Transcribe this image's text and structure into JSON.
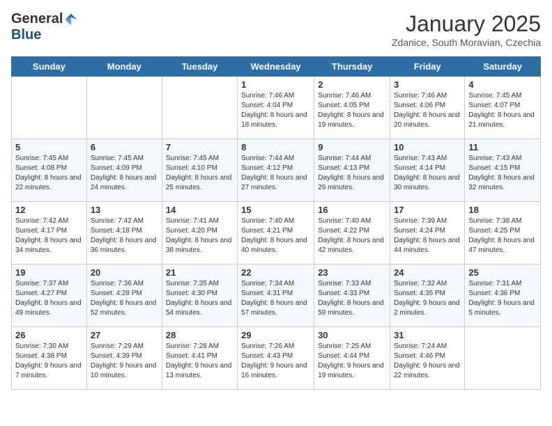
{
  "logo": {
    "general": "General",
    "blue": "Blue"
  },
  "title": "January 2025",
  "subtitle": "Zdanice, South Moravian, Czechia",
  "days": [
    "Sunday",
    "Monday",
    "Tuesday",
    "Wednesday",
    "Thursday",
    "Friday",
    "Saturday"
  ],
  "weeks": [
    [
      {
        "day": "",
        "info": ""
      },
      {
        "day": "",
        "info": ""
      },
      {
        "day": "",
        "info": ""
      },
      {
        "day": "1",
        "info": "Sunrise: 7:46 AM\nSunset: 4:04 PM\nDaylight: 8 hours and 18 minutes."
      },
      {
        "day": "2",
        "info": "Sunrise: 7:46 AM\nSunset: 4:05 PM\nDaylight: 8 hours and 19 minutes."
      },
      {
        "day": "3",
        "info": "Sunrise: 7:46 AM\nSunset: 4:06 PM\nDaylight: 8 hours and 20 minutes."
      },
      {
        "day": "4",
        "info": "Sunrise: 7:45 AM\nSunset: 4:07 PM\nDaylight: 8 hours and 21 minutes."
      }
    ],
    [
      {
        "day": "5",
        "info": "Sunrise: 7:45 AM\nSunset: 4:08 PM\nDaylight: 8 hours and 22 minutes."
      },
      {
        "day": "6",
        "info": "Sunrise: 7:45 AM\nSunset: 4:09 PM\nDaylight: 8 hours and 24 minutes."
      },
      {
        "day": "7",
        "info": "Sunrise: 7:45 AM\nSunset: 4:10 PM\nDaylight: 8 hours and 25 minutes."
      },
      {
        "day": "8",
        "info": "Sunrise: 7:44 AM\nSunset: 4:12 PM\nDaylight: 8 hours and 27 minutes."
      },
      {
        "day": "9",
        "info": "Sunrise: 7:44 AM\nSunset: 4:13 PM\nDaylight: 8 hours and 29 minutes."
      },
      {
        "day": "10",
        "info": "Sunrise: 7:43 AM\nSunset: 4:14 PM\nDaylight: 8 hours and 30 minutes."
      },
      {
        "day": "11",
        "info": "Sunrise: 7:43 AM\nSunset: 4:15 PM\nDaylight: 8 hours and 32 minutes."
      }
    ],
    [
      {
        "day": "12",
        "info": "Sunrise: 7:42 AM\nSunset: 4:17 PM\nDaylight: 8 hours and 34 minutes."
      },
      {
        "day": "13",
        "info": "Sunrise: 7:42 AM\nSunset: 4:18 PM\nDaylight: 8 hours and 36 minutes."
      },
      {
        "day": "14",
        "info": "Sunrise: 7:41 AM\nSunset: 4:20 PM\nDaylight: 8 hours and 38 minutes."
      },
      {
        "day": "15",
        "info": "Sunrise: 7:40 AM\nSunset: 4:21 PM\nDaylight: 8 hours and 40 minutes."
      },
      {
        "day": "16",
        "info": "Sunrise: 7:40 AM\nSunset: 4:22 PM\nDaylight: 8 hours and 42 minutes."
      },
      {
        "day": "17",
        "info": "Sunrise: 7:39 AM\nSunset: 4:24 PM\nDaylight: 8 hours and 44 minutes."
      },
      {
        "day": "18",
        "info": "Sunrise: 7:38 AM\nSunset: 4:25 PM\nDaylight: 8 hours and 47 minutes."
      }
    ],
    [
      {
        "day": "19",
        "info": "Sunrise: 7:37 AM\nSunset: 4:27 PM\nDaylight: 8 hours and 49 minutes."
      },
      {
        "day": "20",
        "info": "Sunrise: 7:36 AM\nSunset: 4:28 PM\nDaylight: 8 hours and 52 minutes."
      },
      {
        "day": "21",
        "info": "Sunrise: 7:35 AM\nSunset: 4:30 PM\nDaylight: 8 hours and 54 minutes."
      },
      {
        "day": "22",
        "info": "Sunrise: 7:34 AM\nSunset: 4:31 PM\nDaylight: 8 hours and 57 minutes."
      },
      {
        "day": "23",
        "info": "Sunrise: 7:33 AM\nSunset: 4:33 PM\nDaylight: 8 hours and 59 minutes."
      },
      {
        "day": "24",
        "info": "Sunrise: 7:32 AM\nSunset: 4:35 PM\nDaylight: 9 hours and 2 minutes."
      },
      {
        "day": "25",
        "info": "Sunrise: 7:31 AM\nSunset: 4:36 PM\nDaylight: 9 hours and 5 minutes."
      }
    ],
    [
      {
        "day": "26",
        "info": "Sunrise: 7:30 AM\nSunset: 4:38 PM\nDaylight: 9 hours and 7 minutes."
      },
      {
        "day": "27",
        "info": "Sunrise: 7:29 AM\nSunset: 4:39 PM\nDaylight: 9 hours and 10 minutes."
      },
      {
        "day": "28",
        "info": "Sunrise: 7:28 AM\nSunset: 4:41 PM\nDaylight: 9 hours and 13 minutes."
      },
      {
        "day": "29",
        "info": "Sunrise: 7:26 AM\nSunset: 4:43 PM\nDaylight: 9 hours and 16 minutes."
      },
      {
        "day": "30",
        "info": "Sunrise: 7:25 AM\nSunset: 4:44 PM\nDaylight: 9 hours and 19 minutes."
      },
      {
        "day": "31",
        "info": "Sunrise: 7:24 AM\nSunset: 4:46 PM\nDaylight: 9 hours and 22 minutes."
      },
      {
        "day": "",
        "info": ""
      }
    ]
  ]
}
